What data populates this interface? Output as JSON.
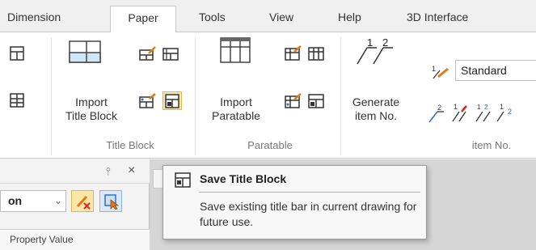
{
  "tabs": [
    {
      "label": "Dimension",
      "active": false
    },
    {
      "label": "Paper",
      "active": true
    },
    {
      "label": "Tools",
      "active": false
    },
    {
      "label": "View",
      "active": false
    },
    {
      "label": "Help",
      "active": false
    },
    {
      "label": "3D Interface",
      "active": false
    }
  ],
  "ribbon": {
    "title_block": {
      "group_label": "Title Block",
      "import_label_line1": "Import",
      "import_label_line2": "Title Block"
    },
    "paratable": {
      "group_label": "Paratable",
      "import_label_line1": "Import",
      "import_label_line2": "Paratable"
    },
    "item_no": {
      "group_label": "item No.",
      "generate_label_line1": "Generate",
      "generate_label_line2": "item No.",
      "style_select_value": "Standard",
      "generate_icon_numbers": [
        "1",
        "2"
      ]
    }
  },
  "properties_panel": {
    "pin_glyph": "⫯",
    "close_glyph": "×",
    "combo_value": "on",
    "property_value_header": "Property Value"
  },
  "tooltip": {
    "title": "Save Title Block",
    "description": "Save existing title bar in current drawing for future use."
  },
  "colors": {
    "highlight_fill": "#fde7a8",
    "highlight_border": "#e8b74a",
    "icon_orange": "#e07b1a",
    "icon_red": "#d9281c",
    "icon_blue": "#2c6fc4"
  },
  "icons": [
    "title-block-icon",
    "paratable-icon",
    "generate-item-no-icon",
    "save-title-block-icon",
    "clear-icon",
    "select-icon",
    "pin-icon",
    "close-icon"
  ]
}
